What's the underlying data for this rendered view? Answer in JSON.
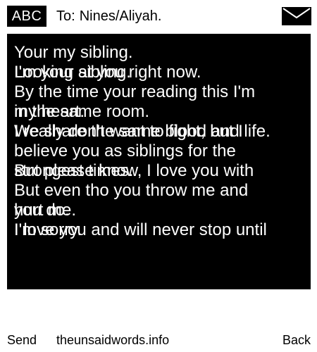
{
  "header": {
    "badge": "ABC",
    "to_label": "To:",
    "recipient": "Nines/Aliyah.",
    "icon": "envelope-icon"
  },
  "message": {
    "layer_a": [
      "Your my sibling.",
      "Looking at you right now.",
      "By the time your reading this I'm",
      "in the same room.",
      "I really don't want to fight, but I",
      "believe you as siblings for the",
      "strongest times.",
      "But even tho you throw me and",
      "you do.",
      "I'm sorry."
    ],
    "layer_b": [
      "I'm your sibling.",
      "",
      "my heart.",
      "We share the same blood and life.",
      "",
      "But please know, I love you with",
      "",
      "hurt me.",
      "I love you and will never stop until"
    ]
  },
  "footer": {
    "send": "Send",
    "site": "theunsaidwords.info",
    "back": "Back"
  },
  "colors": {
    "background": "#ffffff",
    "panel": "#000000",
    "text_on_panel": "#ffffff"
  }
}
